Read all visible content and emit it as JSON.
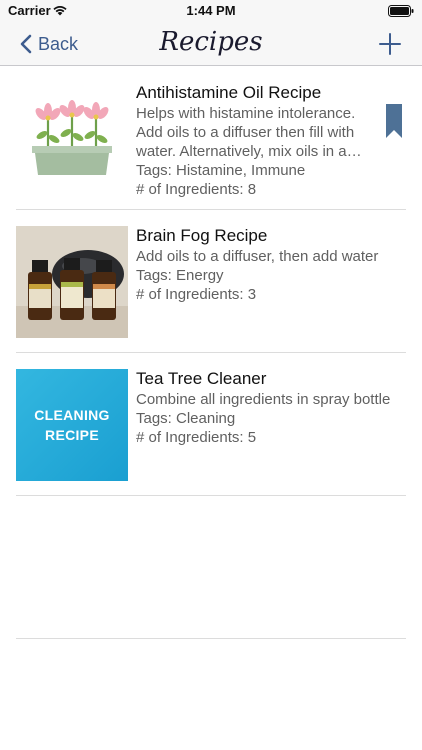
{
  "status_bar": {
    "carrier": "Carrier",
    "time": "1:44 PM"
  },
  "nav": {
    "back_label": "Back",
    "title": "Recipes"
  },
  "recipes": [
    {
      "title": "Antihistamine Oil Recipe",
      "description": "Helps with histamine intolerance. Add oils to a diffuser then fill with water. Alternatively, mix oils in a carrier oil and apply topically.",
      "tags": "Tags: Histamine, Immune",
      "ingredients": "# of Ingredients: 8",
      "image": "flower-planter",
      "bookmarked": true
    },
    {
      "title": "Brain Fog Recipe",
      "description": "Add oils to a diffuser, then add water",
      "tags": "Tags: Energy",
      "ingredients": "# of Ingredients: 3",
      "image": "oil-bottles-photo",
      "bookmarked": false
    },
    {
      "title": "Tea Tree Cleaner",
      "description": "Combine all ingredients in spray bottle",
      "tags": "Tags: Cleaning",
      "ingredients": "# of Ingredients: 5",
      "image": "cleaning-recipe-card",
      "image_text": [
        "CLEANING",
        "RECIPE"
      ],
      "bookmarked": false
    }
  ],
  "colors": {
    "accent": "#3d5c8e",
    "bookmark": "#4e7196",
    "cleaning_blue": "#2aaedb"
  }
}
